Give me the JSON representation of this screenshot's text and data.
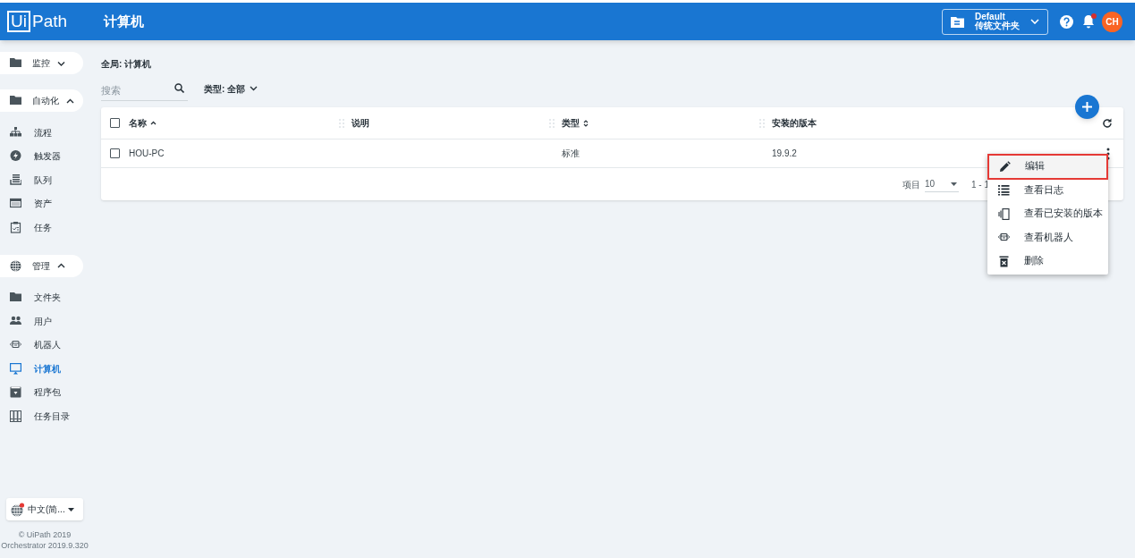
{
  "header": {
    "logo_box": "Ui",
    "logo_text": "Path",
    "title": "计算机",
    "folder": {
      "name": "Default",
      "subtitle": "传统文件夹"
    },
    "avatar": "CH",
    "notification_dot": true
  },
  "sidebar": {
    "groups": [
      {
        "label": "监控",
        "expanded": false
      },
      {
        "label": "自动化",
        "expanded": true,
        "items": [
          {
            "label": "流程",
            "selected": false
          },
          {
            "label": "触发器",
            "selected": false
          },
          {
            "label": "队列",
            "selected": false
          },
          {
            "label": "资产",
            "selected": false
          },
          {
            "label": "任务",
            "selected": false
          }
        ]
      },
      {
        "label": "管理",
        "expanded": true,
        "items": [
          {
            "label": "文件夹",
            "selected": false
          },
          {
            "label": "用户",
            "selected": false
          },
          {
            "label": "机器人",
            "selected": false
          },
          {
            "label": "计算机",
            "selected": true
          },
          {
            "label": "程序包",
            "selected": false
          },
          {
            "label": "任务目录",
            "selected": false
          }
        ]
      }
    ],
    "language": "中文(简...",
    "copyright": "© UiPath 2019",
    "version": "Orchestrator 2019.9.320"
  },
  "breadcrumb": "全局: 计算机",
  "search": {
    "placeholder": "搜索"
  },
  "type_filter": "类型: 全部",
  "table": {
    "all_checked": false,
    "columns": [
      {
        "label": "名称",
        "sorted": true,
        "sortable": true
      },
      {
        "label": "说明",
        "sortable": false
      },
      {
        "label": "类型",
        "sortable": true
      },
      {
        "label": "安装的版本",
        "sortable": false
      }
    ],
    "rows": [
      {
        "checked": false,
        "cells": [
          "HOU-PC",
          "",
          "标准",
          "19.9.2"
        ]
      }
    ],
    "footer": {
      "items_label": "项目",
      "page_size": "10",
      "range": "1 - 1"
    }
  },
  "row_menu": {
    "items": [
      {
        "label": "编辑",
        "selected": true
      },
      {
        "label": "查看日志",
        "selected": false
      },
      {
        "label": "查看已安装的版本",
        "selected": false
      },
      {
        "label": "查看机器人",
        "selected": false
      },
      {
        "label": "删除",
        "selected": false
      }
    ]
  }
}
